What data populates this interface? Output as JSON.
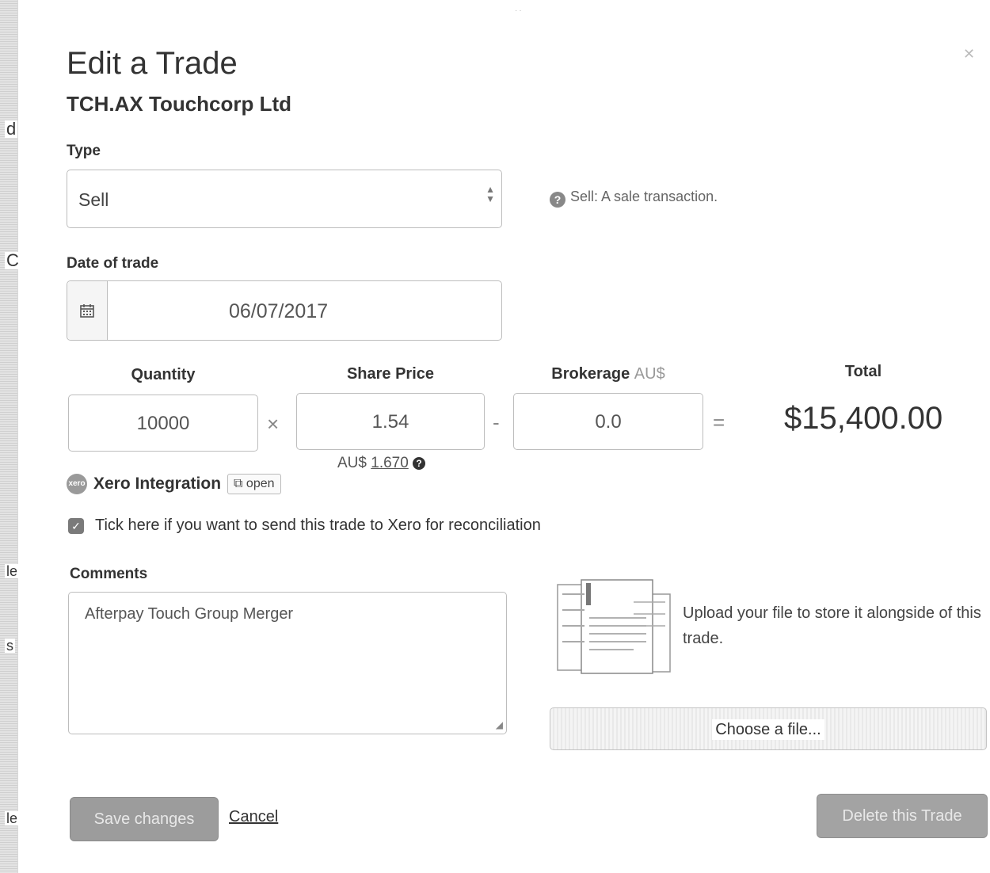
{
  "dialog": {
    "title": "Edit a Trade",
    "subtitle": "TCH.AX Touchcorp Ltd",
    "close_icon": "close-icon"
  },
  "type": {
    "label": "Type",
    "selected": "Sell",
    "hint": "Sell: A sale transaction."
  },
  "date": {
    "label": "Date of trade",
    "value": "06/07/2017",
    "icon": "calendar-icon"
  },
  "trade": {
    "quantity_label": "Quantity",
    "quantity": "10000",
    "price_label": "Share Price",
    "price": "1.54",
    "brokerage_label": "Brokerage",
    "brokerage_currency": "AU$",
    "brokerage": "0.0",
    "total_label": "Total",
    "total": "$15,400.00",
    "op_multiply": "×",
    "op_minus": "-",
    "op_equals": "=",
    "conversion_prefix": "AU$",
    "conversion_value": "1.670"
  },
  "xero": {
    "title": "Xero Integration",
    "open_label": "open",
    "checkbox_label": "Tick here if you want to send this trade to Xero for reconciliation",
    "checked": true
  },
  "comments": {
    "label": "Comments",
    "value": "Afterpay Touch Group Merger"
  },
  "upload": {
    "text": "Upload your file to store it alongside of this trade.",
    "button_label": "Choose a file..."
  },
  "actions": {
    "save_label": "Save changes",
    "cancel_label": "Cancel",
    "delete_label": "Delete this Trade"
  },
  "left_strip": {
    "chars": [
      "d",
      "C",
      "le",
      "s",
      "le"
    ]
  },
  "colors": {
    "text": "#333333",
    "muted": "#999999",
    "button_gray": "#9c9c9c",
    "border": "#bdbdbd"
  }
}
